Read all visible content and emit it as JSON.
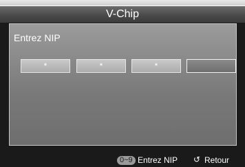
{
  "window": {
    "title": "V-Chip"
  },
  "prompt": "Entrez NIP",
  "pin_fields": [
    {
      "value": "*",
      "active": false
    },
    {
      "value": "*",
      "active": false
    },
    {
      "value": "*",
      "active": false
    },
    {
      "value": "",
      "active": true
    }
  ],
  "footer": {
    "key_hint": "0~9",
    "key_label": "Entrez NIP",
    "return_icon": "return-arrow-icon",
    "return_label": "Retour"
  }
}
